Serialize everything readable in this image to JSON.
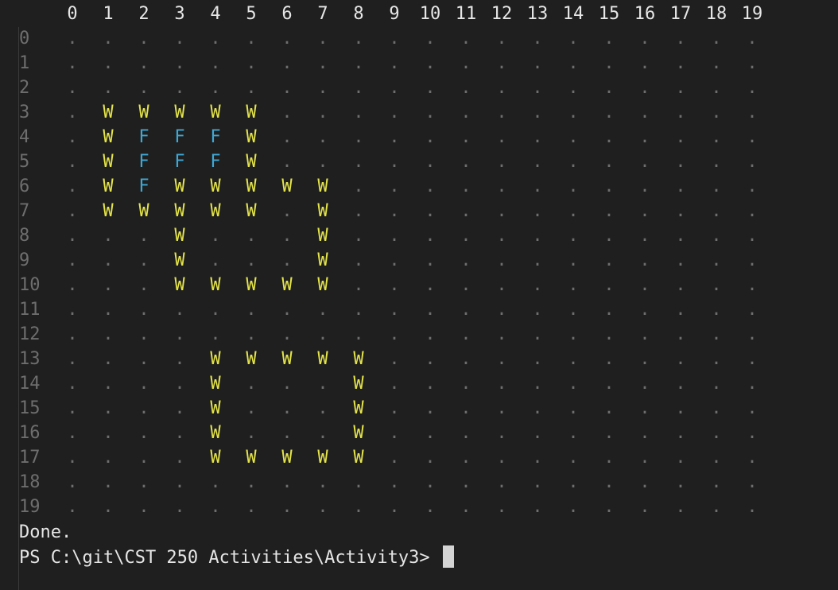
{
  "terminal": {
    "column_headers": [
      "0",
      "1",
      "2",
      "3",
      "4",
      "5",
      "6",
      "7",
      "8",
      "9",
      "10",
      "11",
      "12",
      "13",
      "14",
      "15",
      "16",
      "17",
      "18",
      "19"
    ],
    "row_labels": [
      "0",
      "1",
      "2",
      "3",
      "4",
      "5",
      "6",
      "7",
      "8",
      "9",
      "10",
      "11",
      "12",
      "13",
      "14",
      "15",
      "16",
      "17",
      "18",
      "19"
    ],
    "grid": [
      "....................",
      "....................",
      "....................",
      ".WWWWW..............",
      ".WFFFW..............",
      ".WFFFW..............",
      ".WFWWWWW............",
      ".WWWWW.W............",
      "...W...W............",
      "...W...W............",
      "...WWWWW............",
      "....................",
      "....................",
      "....WWWWW...........",
      "....W...W...........",
      "....W...W...........",
      "....W...W...........",
      "....WWWWW...........",
      "....................",
      "...................."
    ],
    "legend": {
      "wall_char": "W",
      "fill_char": "F",
      "empty_char": "."
    },
    "colors": {
      "background": "#1f1f1f",
      "wall": "#e5e54a",
      "fill": "#3fa8d6",
      "empty": "#6e6e6e",
      "header": "#e6e6e6"
    },
    "output_done": "Done.",
    "prompt": "PS C:\\git\\CST 250 Activities\\Activity3>"
  }
}
